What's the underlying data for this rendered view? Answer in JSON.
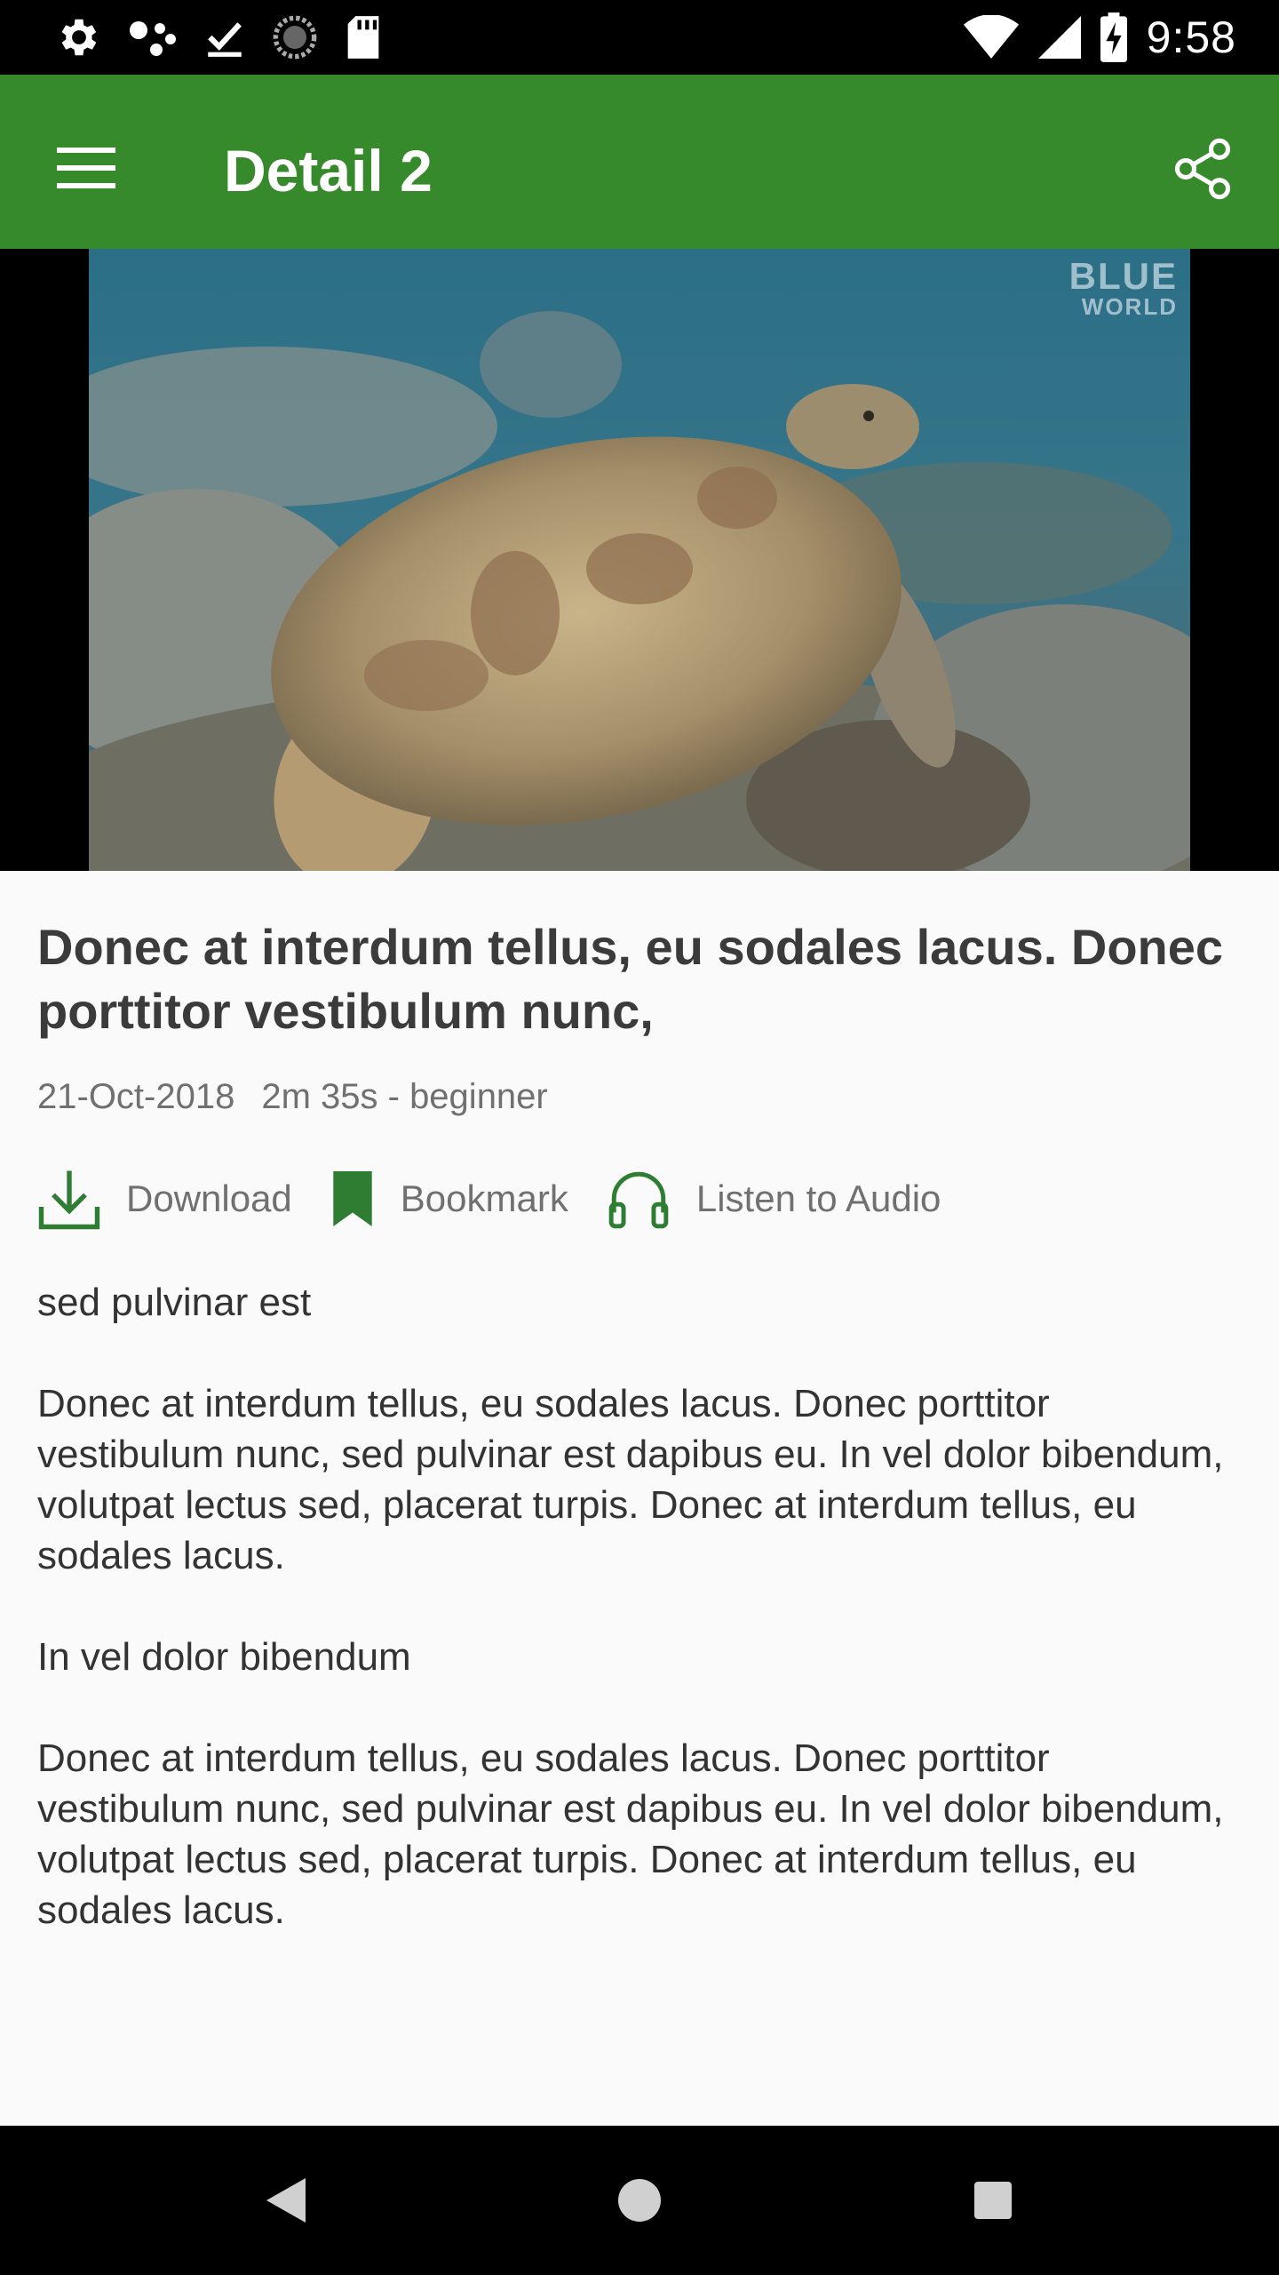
{
  "status_bar": {
    "time": "9:58",
    "left_icons": [
      "settings-icon",
      "assistant-dots-icon",
      "download-done-icon",
      "sync-circle-icon",
      "sd-card-icon"
    ],
    "right_icons": [
      "wifi-icon",
      "cellular-signal-icon",
      "battery-charging-icon"
    ]
  },
  "app_bar": {
    "title": "Detail 2",
    "menu_icon": "menu-icon",
    "share_icon": "share-icon",
    "background": "#378a2b"
  },
  "video": {
    "watermark_line1": "BLUE",
    "watermark_line2": "WORLD"
  },
  "article": {
    "title": "Donec at interdum tellus, eu sodales lacus. Donec porttitor vestibulum nunc,",
    "date": "21-Oct-2018",
    "duration_level": "2m 35s - beginner",
    "actions": {
      "download": "Download",
      "bookmark": "Bookmark",
      "listen": "Listen to Audio"
    },
    "paragraphs": [
      "sed pulvinar est",
      "Donec at interdum tellus, eu sodales lacus. Donec porttitor vestibulum nunc, sed pulvinar est dapibus eu. In vel dolor bibendum, volutpat lectus sed, placerat turpis. Donec at interdum tellus, eu sodales lacus.",
      "In vel dolor bibendum",
      "Donec at interdum tellus, eu sodales lacus. Donec porttitor vestibulum nunc, sed pulvinar est dapibus eu. In vel dolor bibendum, volutpat lectus sed, placerat turpis. Donec at interdum tellus, eu sodales lacus."
    ]
  },
  "nav_bar": {
    "buttons": [
      "back-icon",
      "home-icon",
      "recents-icon"
    ]
  },
  "colors": {
    "accent": "#378a2b",
    "icon_green": "#2e7d32",
    "meta_text": "#707070"
  }
}
